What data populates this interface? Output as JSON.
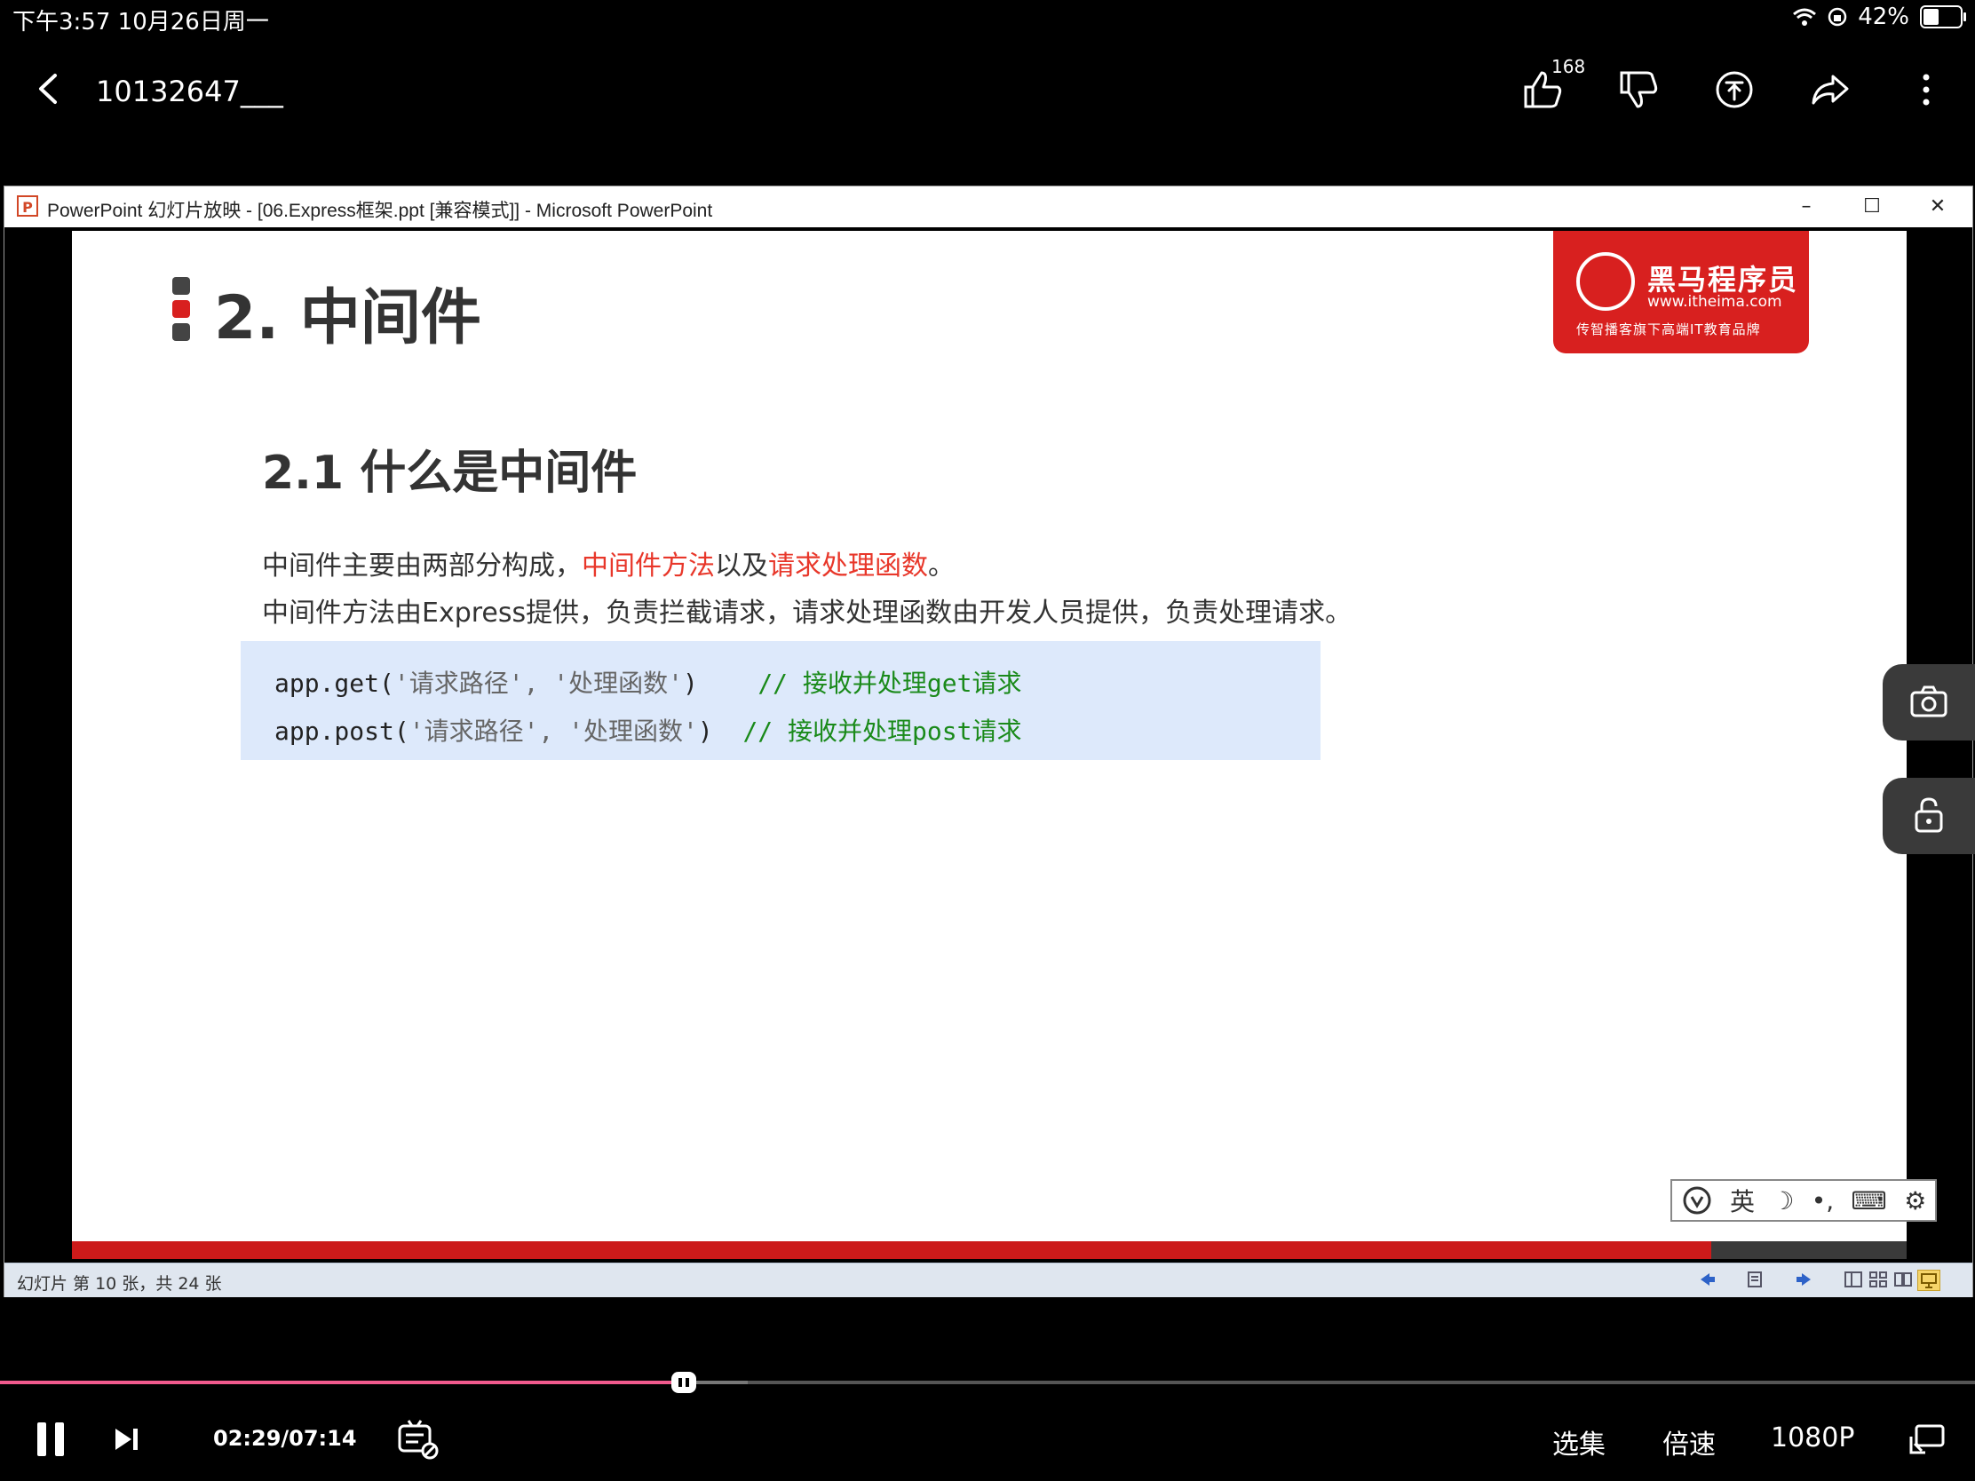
{
  "status_bar": {
    "time_date": "下午3:57   10月26日周一",
    "battery": "42%",
    "battery_level": 0.42
  },
  "player": {
    "title": "10132647___",
    "like_count": "168",
    "icons": [
      "back-icon",
      "thumbs-up-icon",
      "thumbs-down-icon",
      "coin-icon",
      "share-icon",
      "more-icon",
      "camera-icon",
      "lock-icon",
      "pause-icon",
      "next-icon",
      "danmaku-icon",
      "cast-icon"
    ]
  },
  "ppt": {
    "window_title": "PowerPoint 幻灯片放映 - [06.Express框架.ppt [兼容模式]] - Microsoft PowerPoint",
    "logo_letter": "P",
    "minimize": "–",
    "maximize": "☐",
    "close": "✕",
    "status_counter": "幻灯片 第 10 张，共 24 张"
  },
  "slide": {
    "heading": "2. 中间件",
    "subheading": "2.1 什么是中间件",
    "para1_prefix": "中间件主要由两部分构成，",
    "para1_red1": "中间件方法",
    "para1_mid": "以及",
    "para1_red2": "请求处理函数",
    "para1_suffix": "。",
    "para2": "中间件方法由Express提供，负责拦截请求，请求处理函数由开发人员提供，负责处理请求。",
    "code": [
      {
        "fn": "app.get(",
        "args": "'请求路径', '处理函数'",
        "close": ")",
        "pad": "    ",
        "comment": "// 接收并处理get请求"
      },
      {
        "fn": "app.post(",
        "args": "'请求路径', '处理函数'",
        "close": ")",
        "pad": "  ",
        "comment": "// 接收并处理post请求"
      }
    ],
    "brand_name": "黑马程序员",
    "brand_url": "www.itheima.com",
    "brand_slogan": "传智播客旗下高端IT教育品牌",
    "accent_red": "#d8201f"
  },
  "ime": {
    "lang": "英",
    "items": [
      "moon-icon",
      "punctuation-icon",
      "keyboard-icon",
      "gear-icon"
    ]
  },
  "playback": {
    "time": "02:29/07:14",
    "progress_fraction": 0.346,
    "episodes": "选集",
    "speed": "倍速",
    "quality": "1080P"
  }
}
